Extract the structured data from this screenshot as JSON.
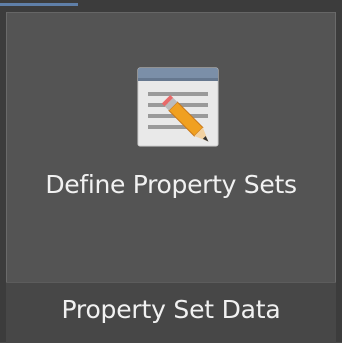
{
  "ribbon_panel": {
    "tool": {
      "label": "Define Property Sets",
      "icon": "document-pencil-icon"
    },
    "panel_title": "Property Set Data"
  },
  "colors": {
    "panel_background": "#545454",
    "footer_background": "#474747",
    "text": "#f1f1f1",
    "accent": "#5f7fa8"
  }
}
